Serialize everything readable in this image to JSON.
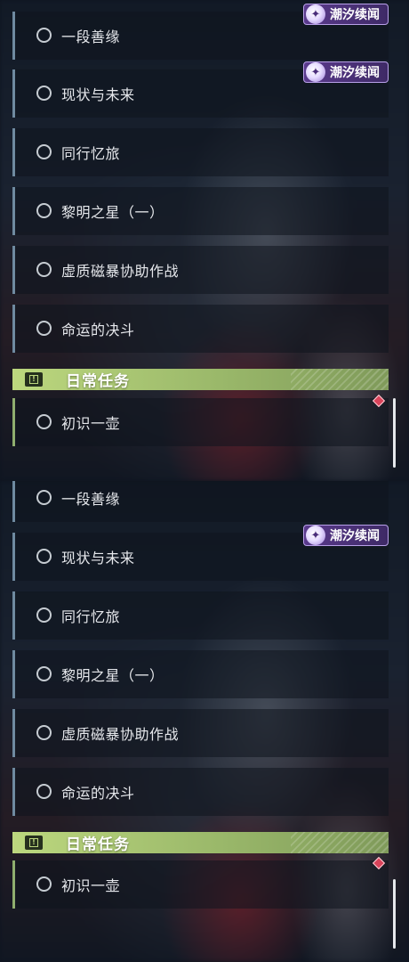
{
  "badge_text": "潮汐续闻",
  "quests": [
    {
      "label": "一段善缘",
      "has_badge": true
    },
    {
      "label": "现状与未来",
      "has_badge": true
    },
    {
      "label": "同行忆旅",
      "has_badge": false
    },
    {
      "label": "黎明之星（一）",
      "has_badge": false
    },
    {
      "label": "虚质磁暴协助作战",
      "has_badge": false
    },
    {
      "label": "命运的决斗",
      "has_badge": false
    }
  ],
  "daily": {
    "title": "日常任务",
    "items": [
      {
        "label": "初识一壶"
      }
    ]
  },
  "colors": {
    "badge_bg": "#4a2f78",
    "daily_header": "#bcd77e",
    "notification": "#d9435a"
  }
}
